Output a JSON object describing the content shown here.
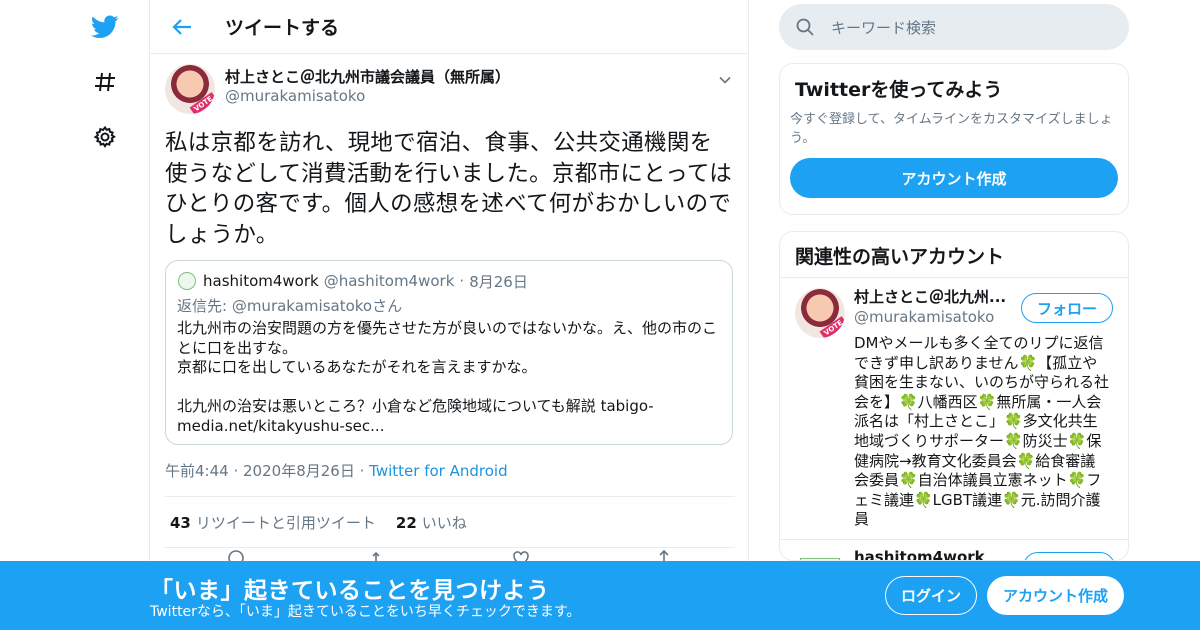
{
  "colors": {
    "brand": "#1da1f2",
    "secondary_text": "#657786",
    "border": "#e6ecf0"
  },
  "header": {
    "title": "ツイートする"
  },
  "tweet": {
    "author_name": "村上さとこ＠北九州市議会議員（無所属）",
    "author_handle": "@murakamisatoko",
    "avatar_badge": "VOTE",
    "text": "私は京都を訪れ、現地で宿泊、食事、公共交通機関を使うなどして消費活動を行いました。京都市にとってはひとりの客です。個人の感想を述べて何がおかしいのでしょうか。",
    "quote": {
      "name": "hashitom4work",
      "handle": "@hashitom4work",
      "date": "8月26日",
      "reply_to": "返信先: @murakamisatokoさん",
      "text": "北九州市の治安問題の方を優先させた方が良いのではないかな。え、他の市のことに口を出すな。\n京都に口を出しているあなたがそれを言えますかな。\n\n北九州の治安は悪いところ？小倉など危険地域についても解説 tabigo-media.net/kitakyushu-sec..."
    },
    "time": "午前4:44",
    "date": "2020年8月26日",
    "source": "Twitter for Android",
    "retweets": "43",
    "retweets_label": "リツイートと引用ツイート",
    "likes": "22",
    "likes_label": "いいね"
  },
  "sidebar": {
    "search_placeholder": "キーワード検索",
    "signup_card": {
      "title": "Twitterを使ってみよう",
      "desc": "今すぐ登録して、タイムラインをカスタマイズしましょう。",
      "button": "アカウント作成"
    },
    "related": {
      "title": "関連性の高いアカウント",
      "accounts": [
        {
          "name": "村上さとこ＠北九州...",
          "handle": "@murakamisatoko",
          "follow": "フォロー",
          "bio": "DMやメールも多く全てのリプに返信できず申し訳ありません🍀【孤立や貧困を生まない、いのちが守られる社会を】🍀八幡西区🍀無所属・一人会派名は「村上さとこ」🍀多文化共生地域づくりサポーター🍀防災士🍀保健病院→教育文化委員会🍀給食審議会委員🍀自治体議員立憲ネット🍀フェミ議連🍀LGBT議連🍀元.訪問介護員"
        },
        {
          "name": "hashitom4work"
        }
      ]
    }
  },
  "banner": {
    "title": "「いま」起きていることを見つけよう",
    "subtitle": "Twitterなら、「いま」起きていることをいち早くチェックできます。",
    "login": "ログイン",
    "signup": "アカウント作成"
  },
  "icons": [
    "twitter-bird-icon",
    "hashtag-icon",
    "gear-icon",
    "back-arrow-icon",
    "chevron-down-icon",
    "search-icon",
    "reply-icon",
    "retweet-icon",
    "like-icon",
    "share-icon"
  ]
}
